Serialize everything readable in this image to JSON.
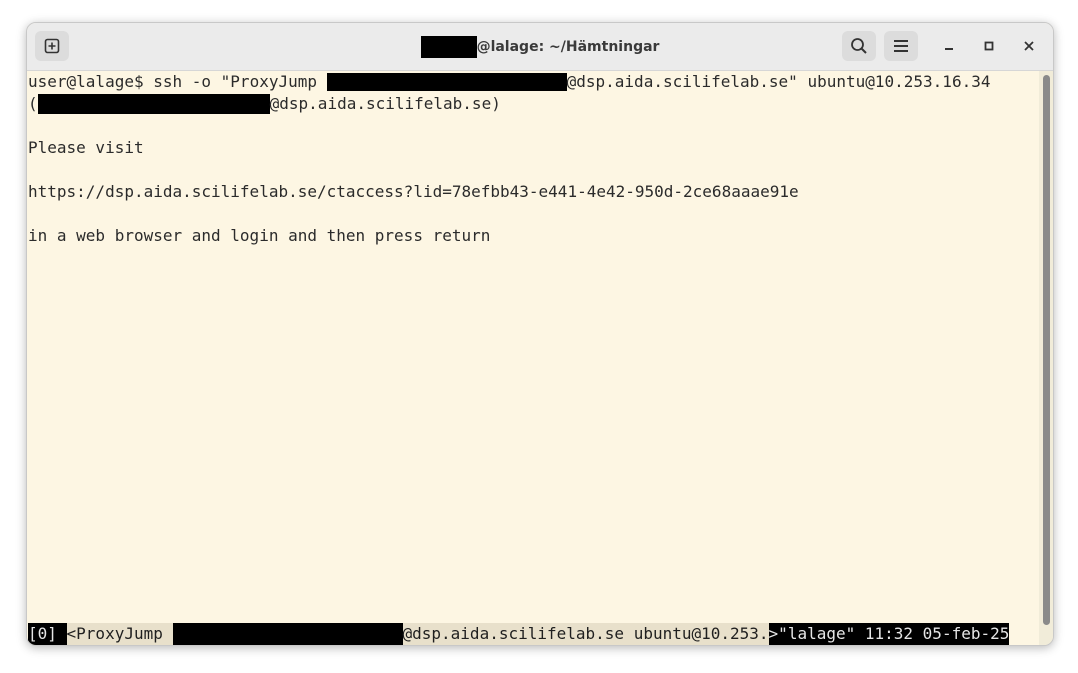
{
  "window": {
    "title_suffix": "@lalage: ~/Hämtningar"
  },
  "terminal": {
    "line1_prompt": "user@lalage$ ",
    "line1_cmd": "ssh -o \"ProxyJump ",
    "line1_after": "@dsp.aida.scilifelab.se\" ubuntu@10.253.16.34",
    "line2_open": "(",
    "line2_after": "@dsp.aida.scilifelab.se)",
    "line4": "Please visit",
    "line6": "https://dsp.aida.scilifelab.se/ctaccess?lid=78efbb43-e441-4e42-950d-2ce68aaae91e",
    "line8": "in a web browser and login and then press return"
  },
  "statusbar": {
    "session": "[0] ",
    "window_prefix": "<ProxyJump ",
    "window_after": "@dsp.aida.scilifelab.se ubuntu@10.253.",
    "right": ">\"lalage\" 11:32 05-feb-25"
  },
  "icons": {
    "new_tab": "new-tab-icon",
    "search": "search-icon",
    "menu": "hamburger-menu-icon",
    "minimize": "minimize-icon",
    "maximize": "maximize-icon",
    "close": "close-icon"
  }
}
